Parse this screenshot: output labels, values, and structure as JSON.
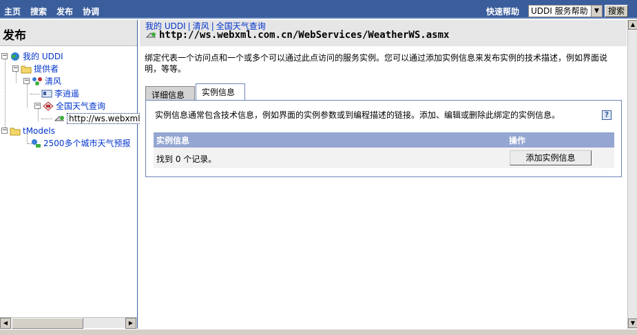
{
  "topbar": {
    "nav": [
      "主页",
      "搜索",
      "发布",
      "协调"
    ],
    "quick_help_label": "快速帮助",
    "help_select_value": "UDDI 服务帮助",
    "search_button": "搜索"
  },
  "left": {
    "title": "发布",
    "tree": {
      "my_uddi": "我的 UDDI",
      "providers": "提供者",
      "provider_name": "清风",
      "contact": "李逍遥",
      "service": "全国天气查询",
      "binding": "http://ws.webxml",
      "tmodels": "tModels",
      "tmodel_item": "2500多个城市天气预报"
    }
  },
  "right": {
    "breadcrumb": [
      "我的 UDDI",
      "清风",
      "全国天气查询"
    ],
    "breadcrumb_sep": "|",
    "url": "http://ws.webxml.com.cn/WebServices/WeatherWS.asmx",
    "description": "绑定代表一个访问点和一个或多个可以通过此点访问的服务实例。您可以通过添加实例信息来发布实例的技术描述，例如界面说明，等等。",
    "tabs": [
      "详细信息",
      "实例信息"
    ],
    "panel": {
      "intro": "实例信息通常包含技术信息，例如界面的实例参数或到编程描述的链接。添加、编辑或删除此绑定的实例信息。",
      "help_icon": "?",
      "col_instance": "实例信息",
      "col_action": "操作",
      "found_text": "找到 0 个记录。",
      "add_button": "添加实例信息"
    }
  },
  "colors": {
    "topbar": "#3a5d9c",
    "grid_header": "#94a6d1",
    "link": "#0033cc"
  }
}
